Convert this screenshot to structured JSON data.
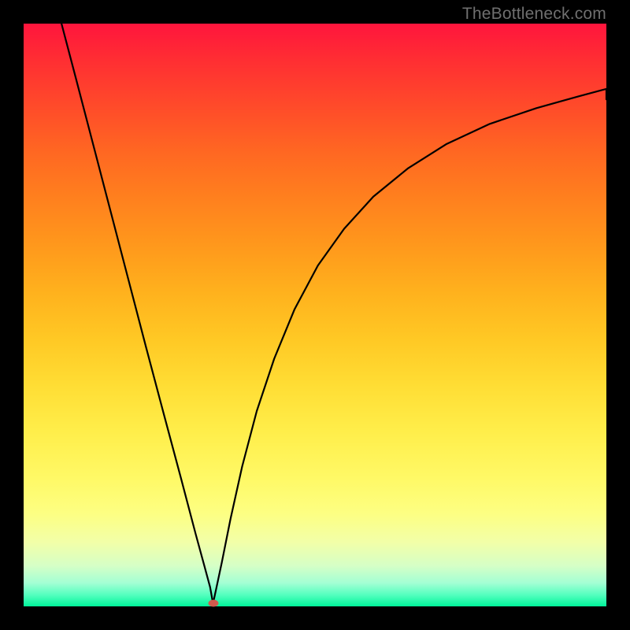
{
  "watermark": "TheBottleneck.com",
  "chart_data": {
    "type": "line",
    "title": "",
    "xlabel": "",
    "ylabel": "",
    "xlim": [
      0,
      1
    ],
    "ylim": [
      0,
      1
    ],
    "grid": false,
    "legend": false,
    "marker": {
      "x": 0.325,
      "y": 0.005,
      "color": "#d15a4d"
    },
    "series": [
      {
        "name": "curve",
        "color": "#000000",
        "x": [
          0.065,
          0.09,
          0.12,
          0.15,
          0.18,
          0.21,
          0.24,
          0.27,
          0.295,
          0.31,
          0.32,
          0.325,
          0.33,
          0.34,
          0.355,
          0.375,
          0.4,
          0.43,
          0.465,
          0.505,
          0.55,
          0.6,
          0.66,
          0.725,
          0.8,
          0.88,
          0.955,
          1.0,
          1.0
        ],
        "y": [
          1.0,
          0.905,
          0.79,
          0.675,
          0.56,
          0.445,
          0.332,
          0.22,
          0.125,
          0.07,
          0.033,
          0.005,
          0.028,
          0.075,
          0.15,
          0.24,
          0.335,
          0.425,
          0.51,
          0.585,
          0.648,
          0.703,
          0.752,
          0.793,
          0.828,
          0.855,
          0.876,
          0.888,
          0.87
        ]
      }
    ],
    "background_gradient_stops": [
      {
        "pos": 0.0,
        "color": "#ff153d"
      },
      {
        "pos": 0.5,
        "color": "#ffc020"
      },
      {
        "pos": 0.8,
        "color": "#fdff82"
      },
      {
        "pos": 1.0,
        "color": "#00f59a"
      }
    ]
  }
}
